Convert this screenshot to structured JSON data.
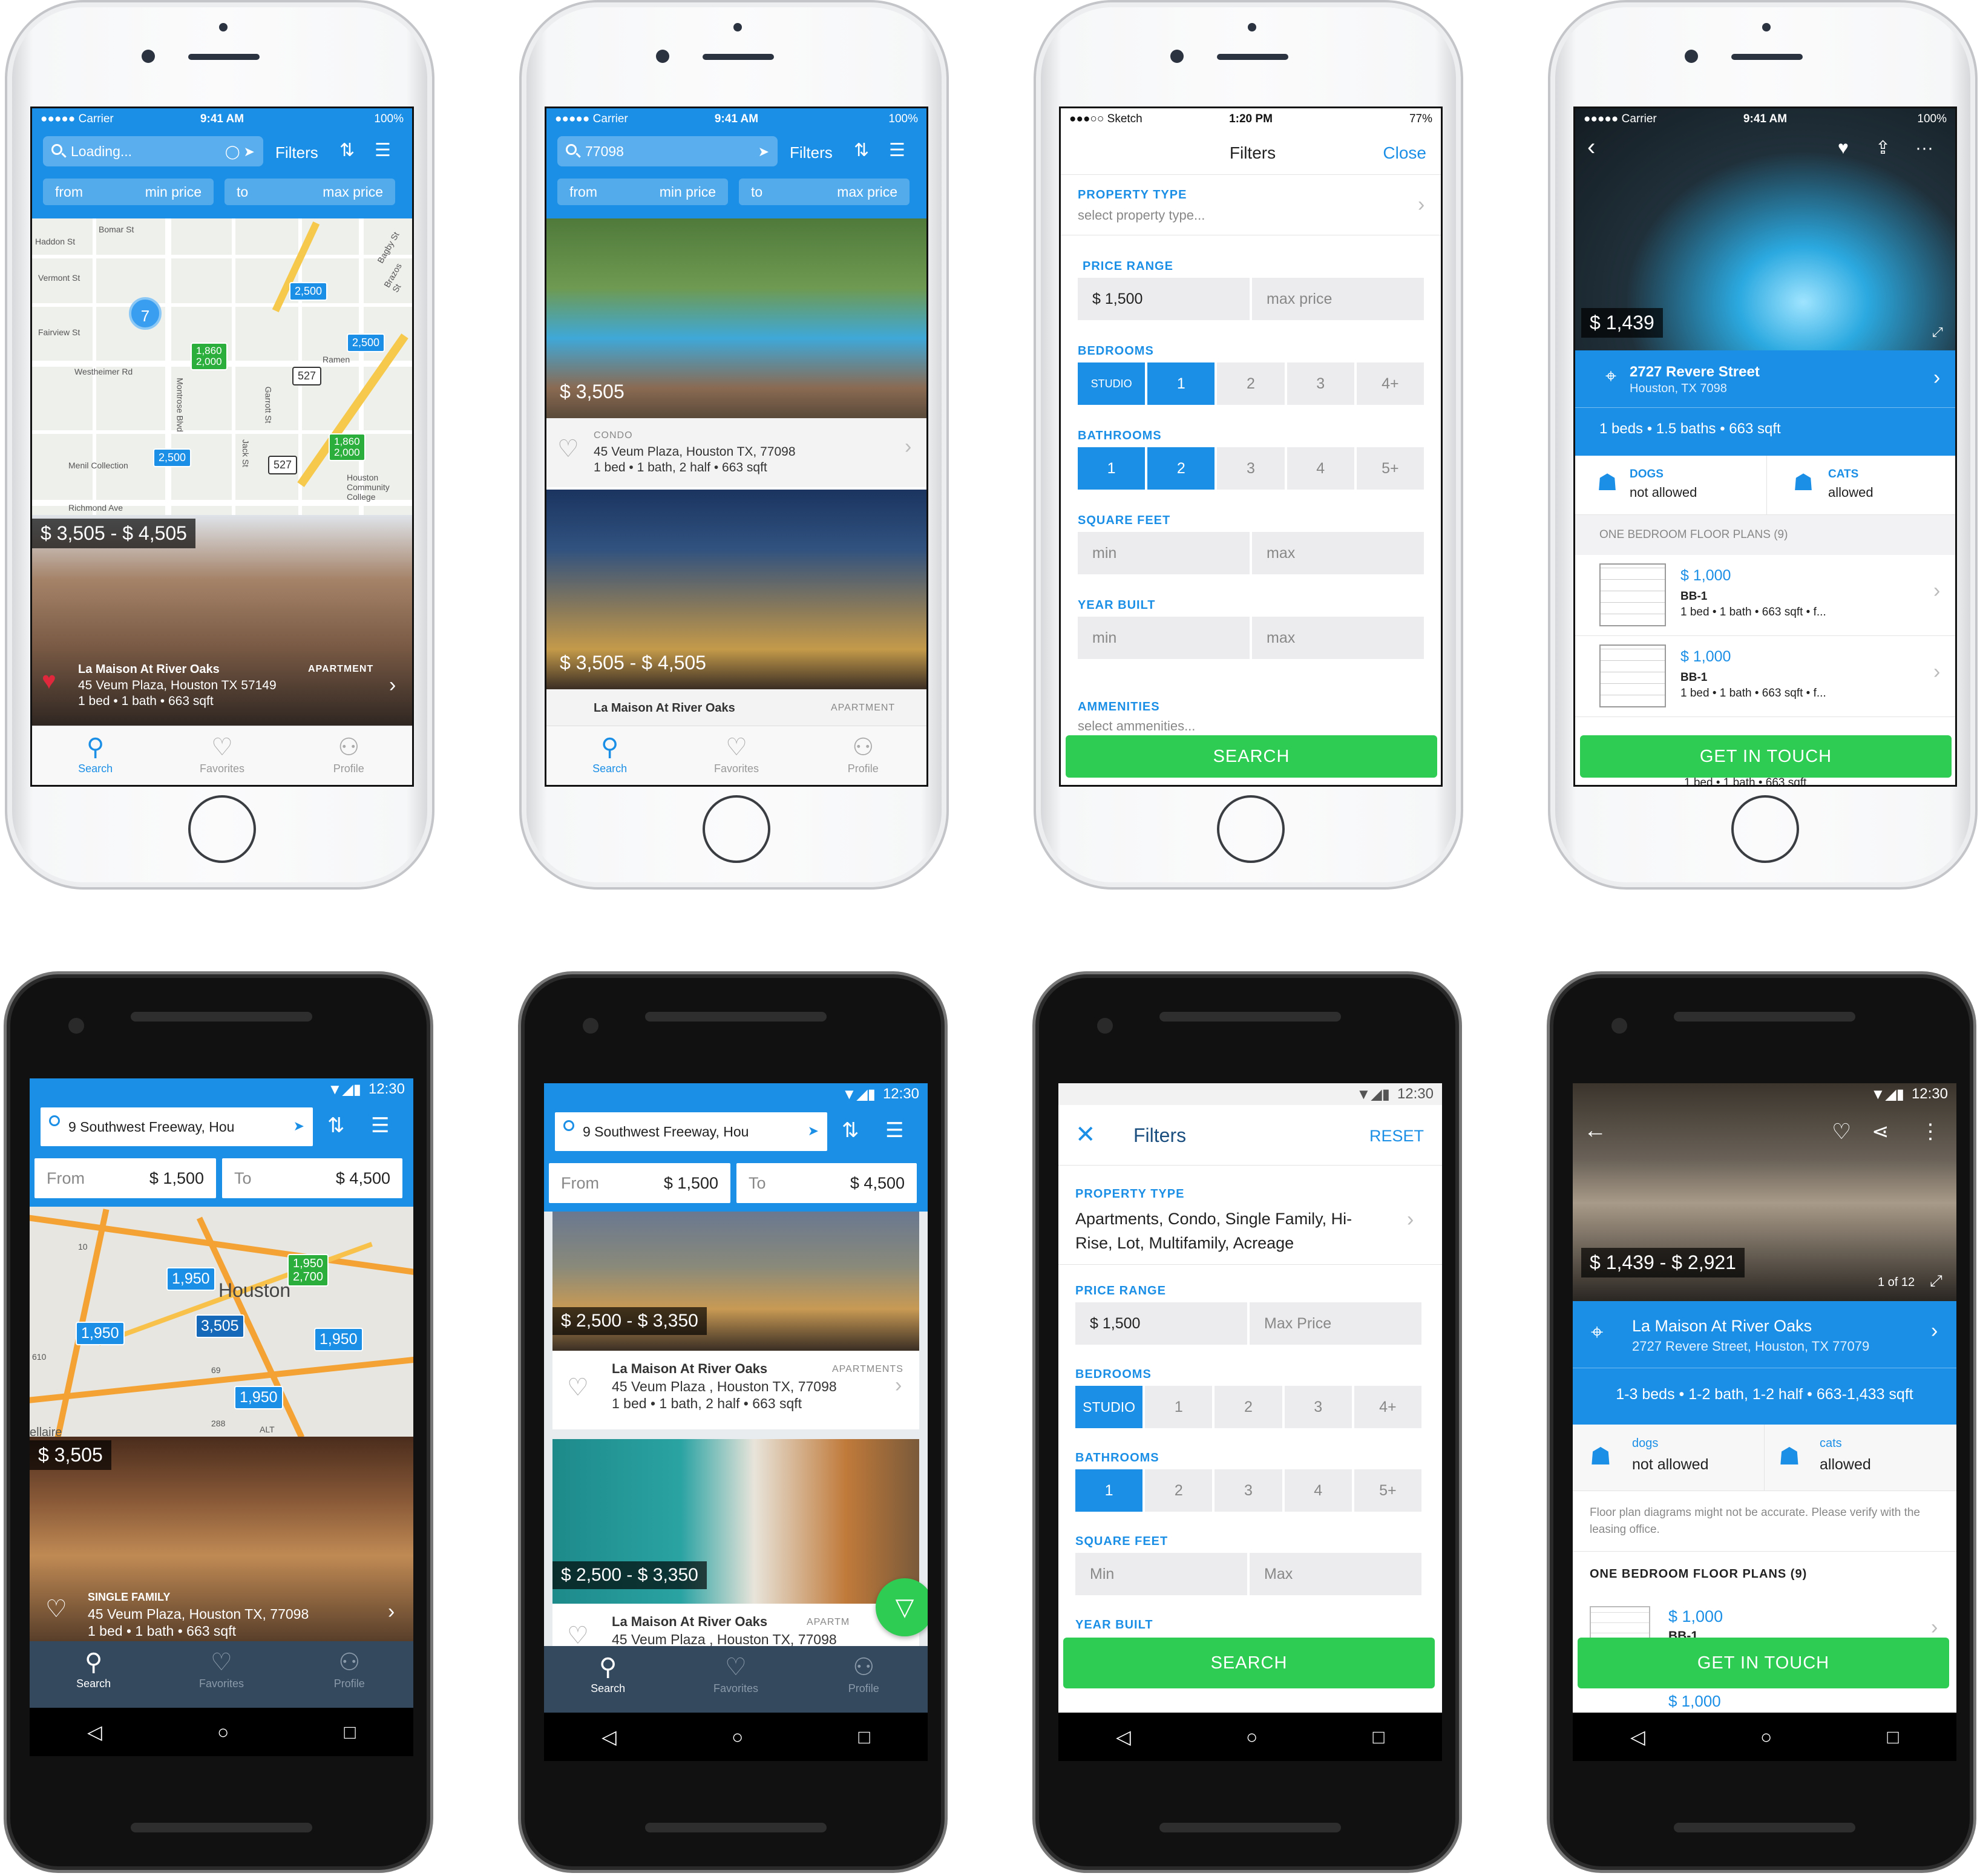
{
  "ios_status": {
    "carrier": "●●●●● Carrier",
    "time": "9:41 AM",
    "battery": "100%"
  },
  "ios_status_filters": {
    "carrier": "●●●○○ Sketch",
    "time": "1:20 PM",
    "battery": "77%"
  },
  "android_status": {
    "time": "12:30"
  },
  "screen1": {
    "search": "Loading...",
    "filters": "Filters",
    "from": "from",
    "min": "min price",
    "to": "to",
    "max": "max price",
    "cluster": "7",
    "pins": [
      "2,500",
      "2,500",
      "2,500"
    ],
    "gpins": [
      "1,860\n2,000",
      "1,860\n2,000"
    ],
    "badge": "527",
    "badge2": "527",
    "streets": [
      "Bomar St",
      "Haddon St",
      "Vermont St",
      "Fairview St",
      "Westheimer Rd",
      "Montrose Blvd",
      "Richmond Ave",
      "Menil Collection",
      "Bagby St",
      "Brazos St",
      "Ramen",
      "Houston Community College",
      "Jack St",
      "Garrott St"
    ],
    "price": "$ 3,505 - $ 4,505",
    "name": "La Maison At River Oaks",
    "type": "APARTMENT",
    "addr": "45 Veum Plaza, Houston TX 57149",
    "meta": "1 bed • 1 bath • 663 sqft"
  },
  "screen2": {
    "search": "77098",
    "price1": "$ 3,505",
    "type1": "CONDO",
    "addr1": "45 Veum Plaza, Houston TX, 77098",
    "meta1": "1 bed • 1 bath, 2 half • 663 sqft",
    "price2": "$ 3,505 - $ 4,505",
    "name2": "La Maison At River Oaks",
    "type2": "APARTMENT"
  },
  "screen3": {
    "title": "Filters",
    "close": "Close",
    "property_type": "PROPERTY TYPE",
    "property_ph": "select property type...",
    "price_range": "PRICE RANGE",
    "min_val": "$ 1,500",
    "max_ph": "max price",
    "bedrooms": "BEDROOMS",
    "bed_opts": [
      "STUDIO",
      "1",
      "2",
      "3",
      "4+"
    ],
    "bathrooms": "BATHROOMS",
    "bath_opts": [
      "1",
      "2",
      "3",
      "4",
      "5+"
    ],
    "sqft": "SQUARE FEET",
    "min": "min",
    "max": "max",
    "year": "YEAR BUILT",
    "amen": "AMMENITIES",
    "amen_ph": "select ammenities...",
    "search": "SEARCH"
  },
  "screen4": {
    "price": "$ 1,439",
    "street": "2727 Revere Street",
    "city": "Houston, TX 7098",
    "meta": "1 beds • 1.5 baths • 663 sqft",
    "dogs": "DOGS",
    "dogs_v": "not allowed",
    "cats": "CATS",
    "cats_v": "allowed",
    "plans": "ONE BEDROOM FLOOR PLANS (9)",
    "plan_price": "$ 1,000",
    "plan_name": "BB-1",
    "plan_meta": "1 bed • 1 bath • 663 sqft • f...",
    "cta": "GET IN TOUCH",
    "under_text": "1 bed • 1 bath • 663 sqft"
  },
  "screen5": {
    "search": "9 Southwest Freeway, Hou",
    "from": "From",
    "from_v": "$ 1,500",
    "to": "To",
    "to_v": "$ 4,500",
    "city": "Houston",
    "pins": [
      "1,950",
      "1,950",
      "3,505",
      "1,950",
      "1,950"
    ],
    "gpin": "1,950\n2,700",
    "price": "$ 3,505",
    "type": "SINGLE FAMILY",
    "addr": "45 Veum Plaza, Houston TX, 77098",
    "meta": "1 bed • 1 bath • 663 sqft",
    "road_labels": [
      "10",
      "610",
      "69",
      "288",
      "ALT",
      "ellaire"
    ]
  },
  "screen6": {
    "price1": "$ 2,500 - $ 3,350",
    "name": "La Maison At River Oaks",
    "type": "APARTMENTS",
    "addr": "45 Veum Plaza , Houston TX, 77098",
    "meta": "1 bed • 1 bath, 2 half • 663 sqft",
    "price2": "$ 2,500 - $ 3,350",
    "type2": "APARTM"
  },
  "screen7": {
    "title": "Filters",
    "reset": "RESET",
    "property_type": "PROPERTY TYPE",
    "property_v": "Apartments, Condo, Single Family, Hi-Rise, Lot, Multifamily, Acreage",
    "price_range": "PRICE RANGE",
    "min_val": "$ 1,500",
    "max_ph": "Max Price",
    "bedrooms": "BEDROOMS",
    "bathrooms": "BATHROOMS",
    "sqft": "SQUARE FEET",
    "min": "Min",
    "max": "Max",
    "year": "YEAR BUILT",
    "search": "SEARCH"
  },
  "screen8": {
    "price": "$ 1,439 - $ 2,921",
    "counter": "1 of 12",
    "name": "La Maison At River Oaks",
    "addr": "2727 Revere Street, Houston, TX 77079",
    "meta": "1-3 beds • 1-2 bath, 1-2 half • 663-1,433 sqft",
    "dogs": "dogs",
    "dogs_v": "not allowed",
    "cats": "cats",
    "cats_v": "allowed",
    "note": "Floor plan diagrams might not be accurate. Please verify with the leasing office.",
    "plans": "ONE BEDROOM FLOOR PLANS (9)",
    "plan_price": "$ 1,000",
    "plan_name": "BB-1",
    "under_price": "$ 1,000",
    "cta": "GET IN TOUCH"
  },
  "tabs": {
    "search": "Search",
    "favorites": "Favorites",
    "profile": "Profile"
  },
  "colors": {
    "brand": "#1b8fe6",
    "cta": "#2ecc52"
  }
}
